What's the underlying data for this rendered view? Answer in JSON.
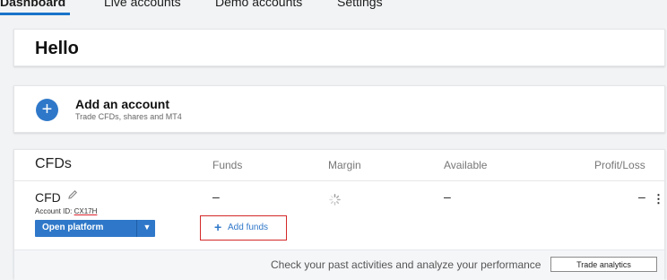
{
  "nav": {
    "tabs": [
      {
        "label": "Dashboard",
        "active": true
      },
      {
        "label": "Live accounts"
      },
      {
        "label": "Demo accounts"
      },
      {
        "label": "Settings"
      }
    ]
  },
  "hello": {
    "title": "Hello"
  },
  "add_account": {
    "icon": "plus-icon",
    "title": "Add an account",
    "subtitle": "Trade CFDs, shares and MT4"
  },
  "cfds": {
    "title": "CFDs",
    "columns": [
      "Funds",
      "Margin",
      "Available",
      "Profit/Loss"
    ],
    "account": {
      "name": "CFD",
      "id_label": "Account ID:",
      "id_value": "CX17H",
      "funds": "–",
      "available": "–",
      "profit_loss": "–",
      "open_button": "Open platform",
      "add_funds": "Add funds"
    },
    "footer_text": "Check your past activities and analyze your performance",
    "trade_analytics": "Trade analytics"
  },
  "colors": {
    "accent": "#2f78c9",
    "highlight_border": "#d42828"
  }
}
